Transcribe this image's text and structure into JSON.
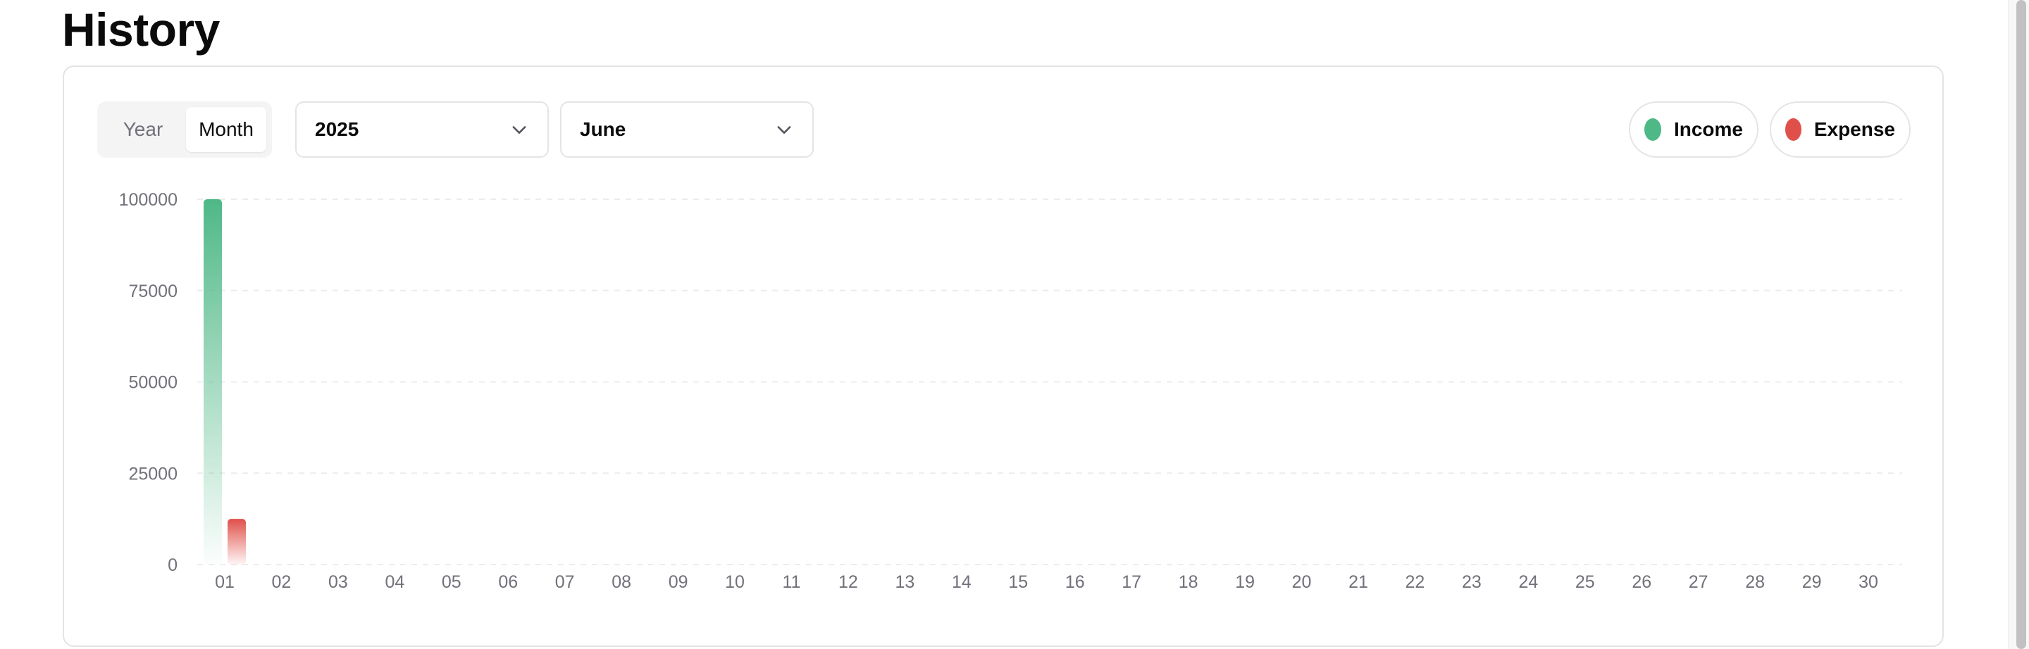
{
  "page": {
    "title": "History"
  },
  "toggle": {
    "options": [
      "Year",
      "Month"
    ],
    "active": "Month"
  },
  "filters": {
    "year": {
      "value": "2025",
      "icon": "chevron-down-icon"
    },
    "month": {
      "value": "June",
      "icon": "chevron-down-icon"
    }
  },
  "legend": [
    {
      "label": "Income",
      "color": "#4fb887"
    },
    {
      "label": "Expense",
      "color": "#e0504a"
    }
  ],
  "chart_data": {
    "type": "bar",
    "categories": [
      "01",
      "02",
      "03",
      "04",
      "05",
      "06",
      "07",
      "08",
      "09",
      "10",
      "11",
      "12",
      "13",
      "14",
      "15",
      "16",
      "17",
      "18",
      "19",
      "20",
      "21",
      "22",
      "23",
      "24",
      "25",
      "26",
      "27",
      "28",
      "29",
      "30"
    ],
    "series": [
      {
        "name": "Income",
        "color": "#4fb887",
        "values": [
          100000,
          0,
          0,
          0,
          0,
          0,
          0,
          0,
          0,
          0,
          0,
          0,
          0,
          0,
          0,
          0,
          0,
          0,
          0,
          0,
          0,
          0,
          0,
          0,
          0,
          0,
          0,
          0,
          0,
          0
        ]
      },
      {
        "name": "Expense",
        "color": "#e0504a",
        "values": [
          12500,
          0,
          0,
          0,
          0,
          0,
          0,
          0,
          0,
          0,
          0,
          0,
          0,
          0,
          0,
          0,
          0,
          0,
          0,
          0,
          0,
          0,
          0,
          0,
          0,
          0,
          0,
          0,
          0,
          0
        ]
      }
    ],
    "yticks": [
      0,
      25000,
      50000,
      75000,
      100000
    ],
    "ylim": [
      0,
      100000
    ],
    "grid": true,
    "legend_position": "top-right"
  }
}
